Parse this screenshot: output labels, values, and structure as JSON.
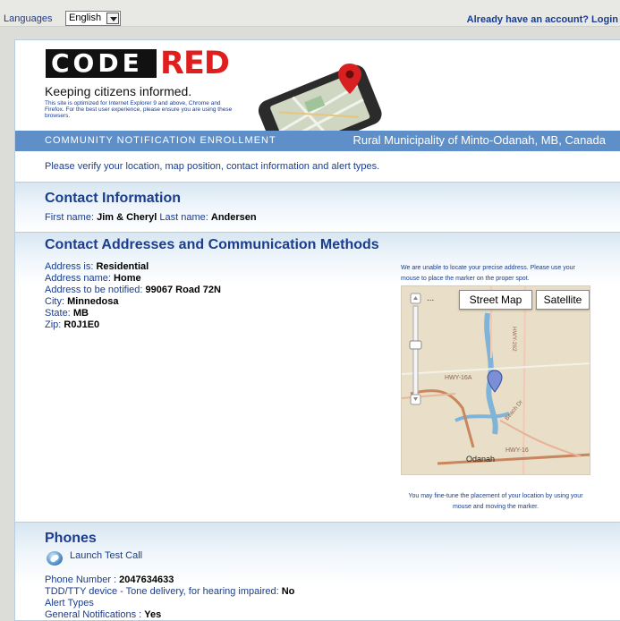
{
  "topbar": {
    "languages_label": "Languages",
    "language_selected": "English",
    "login_link": "Already have an account? Login"
  },
  "header": {
    "logo_code": "CODE",
    "logo_red": "RED",
    "tagline": "Keeping citizens informed.",
    "browser_note": "This site is optimized for Internet Explorer 9 and above, Chrome and Firefox. For the best user experience, please ensure you are using these browsers.",
    "enrollment_title": "COMMUNITY NOTIFICATION ENROLLMENT",
    "municipality": "Rural Municipality of Minto-Odanah, MB, Canada"
  },
  "verify_text": "Please verify your location, map position, contact information and alert types.",
  "contact_info": {
    "title": "Contact Information",
    "first_name_label": "First name:",
    "first_name": "Jim & Cheryl",
    "last_name_label": "Last name:",
    "last_name": "Andersen"
  },
  "addresses": {
    "title": "Contact Addresses and Communication Methods",
    "fields": [
      {
        "label": "Address is:",
        "value": "Residential"
      },
      {
        "label": "Address name:",
        "value": "Home"
      },
      {
        "label": "Address to be notified:",
        "value": "99067 Road 72N"
      },
      {
        "label": "City:",
        "value": "Minnedosa"
      },
      {
        "label": "State:",
        "value": "MB"
      },
      {
        "label": "Zip:",
        "value": "R0J1E0"
      }
    ],
    "map_note": "We are unable to locate your precise address. Please use your mouse to place the marker on the proper spot.",
    "map_hint": "You may fine-tune the placement of your location by using your mouse and moving the marker.",
    "map_buttons": {
      "street": "Street Map",
      "satellite": "Satellite"
    },
    "map_labels": {
      "hwy262": "HWY-262",
      "hwy16a": "HWY-16A",
      "beach": "Beach Dr",
      "hwy16": "HWY-16",
      "town": "Odanah"
    }
  },
  "phones": {
    "title": "Phones",
    "test_call": "Launch Test Call",
    "phone_label": "Phone Number :",
    "phone_value": "2047634633",
    "tdd_label": "TDD/TTY device - Tone delivery, for hearing impaired:",
    "tdd_value": "No",
    "alert_types_label": "Alert Types",
    "general_label": "General Notifications :",
    "general_value": "Yes"
  },
  "colors": {
    "brand_blue": "#1a3d8c",
    "enroll_bar": "#5f8fc9",
    "logo_red": "#e01e1e"
  }
}
